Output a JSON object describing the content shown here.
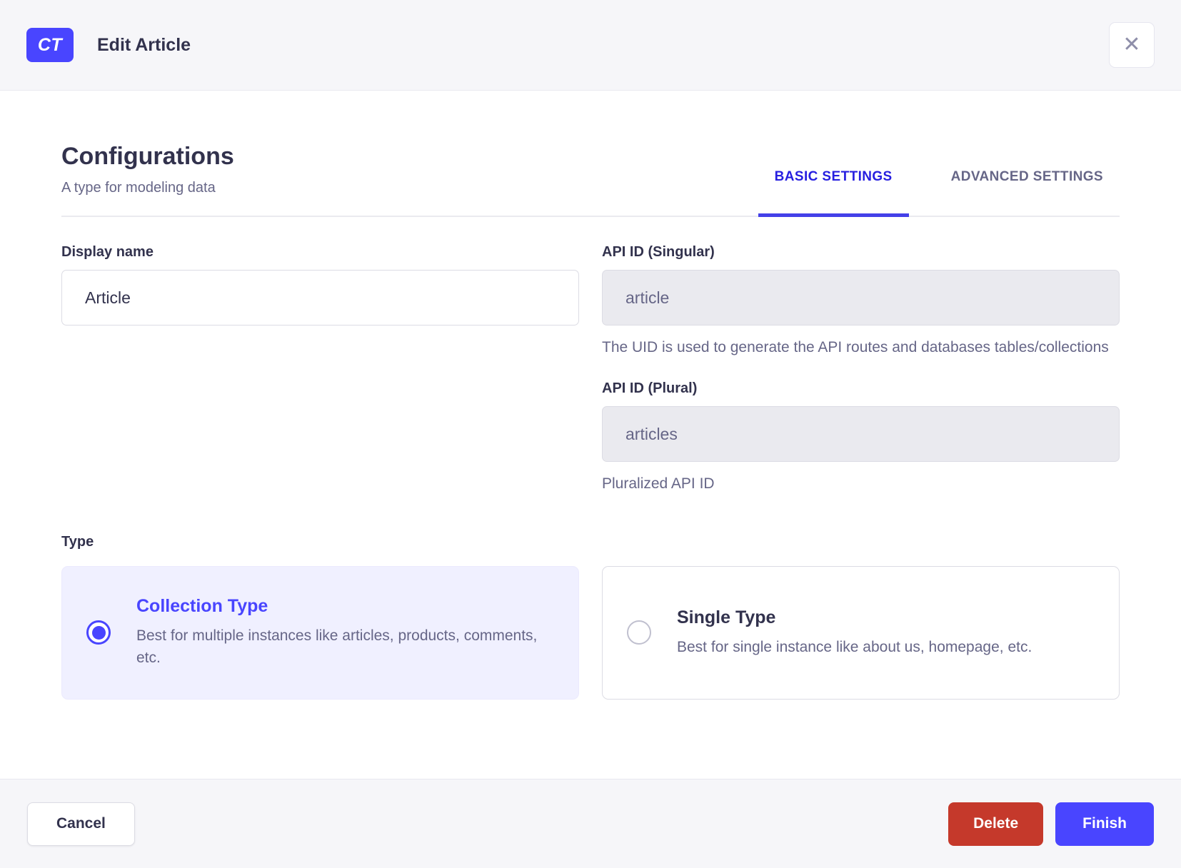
{
  "header": {
    "badge": "CT",
    "title": "Edit Article",
    "close_icon": "✕"
  },
  "config": {
    "title": "Configurations",
    "subtitle": "A type for modeling data",
    "tabs": [
      {
        "label": "BASIC SETTINGS",
        "active": true
      },
      {
        "label": "ADVANCED SETTINGS",
        "active": false
      }
    ]
  },
  "form": {
    "display_name": {
      "label": "Display name",
      "value": "Article"
    },
    "api_id_singular": {
      "label": "API ID (Singular)",
      "value": "article",
      "hint": "The UID is used to generate the API routes and databases tables/collections"
    },
    "api_id_plural": {
      "label": "API ID (Plural)",
      "value": "articles",
      "hint": "Pluralized API ID"
    },
    "type": {
      "label": "Type",
      "options": [
        {
          "title": "Collection Type",
          "description": "Best for multiple instances like articles, products, comments, etc.",
          "selected": true
        },
        {
          "title": "Single Type",
          "description": "Best for single instance like about us, homepage, etc.",
          "selected": false
        }
      ]
    }
  },
  "footer": {
    "cancel_label": "Cancel",
    "delete_label": "Delete",
    "finish_label": "Finish"
  },
  "colors": {
    "primary": "#4945ff",
    "tab_active_text": "#271fe0",
    "danger": "#c5392b",
    "text_dark": "#32324d",
    "text_muted": "#666687",
    "surface_gray": "#f6f6f9",
    "selected_card_bg": "#f0f0ff",
    "disabled_input_bg": "#eaeaef",
    "input_border": "#dcdce4"
  }
}
